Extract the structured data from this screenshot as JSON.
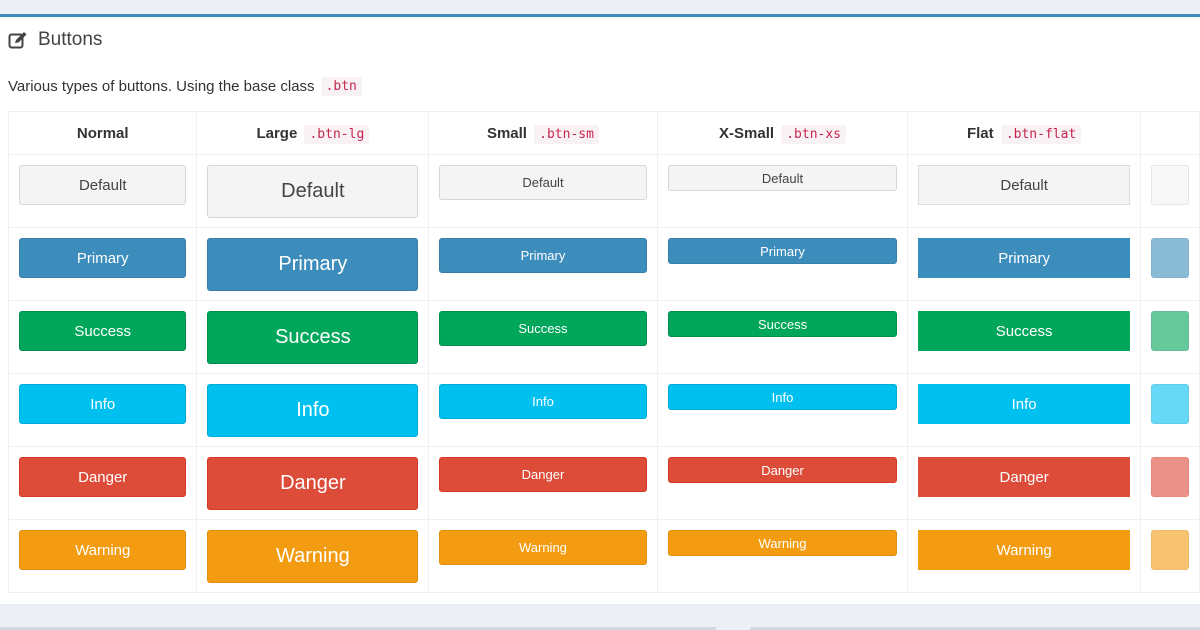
{
  "box": {
    "title": "Buttons",
    "title_icon": "edit-icon",
    "description": "Various types of buttons. Using the base class",
    "description_code": ".btn"
  },
  "columns": [
    {
      "name": "Normal",
      "code": ""
    },
    {
      "name": "Large",
      "code": ".btn-lg"
    },
    {
      "name": "Small",
      "code": ".btn-sm"
    },
    {
      "name": "X-Small",
      "code": ".btn-xs"
    },
    {
      "name": "Flat",
      "code": ".btn-flat"
    }
  ],
  "buttons": {
    "default": "Default",
    "primary": "Primary",
    "success": "Success",
    "info": "Info",
    "danger": "Danger",
    "warning": "Warning"
  },
  "colors": {
    "box_border": "#3c8dbc",
    "default": "#f4f4f4",
    "primary": "#3c8dbc",
    "success": "#00a65a",
    "info": "#00c0ef",
    "danger": "#dd4b39",
    "warning": "#f39c12",
    "code_text": "#c7254e"
  }
}
